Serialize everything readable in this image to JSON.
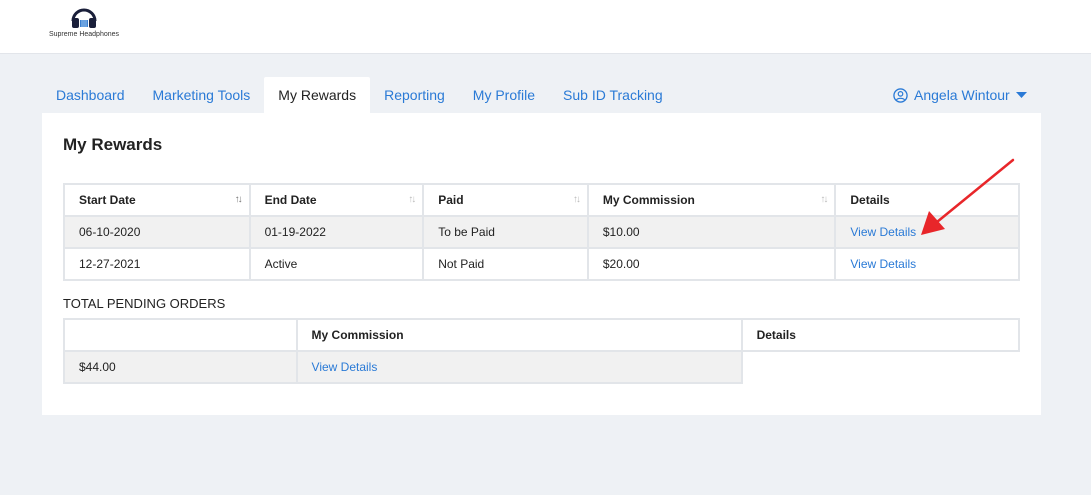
{
  "brand": {
    "name": "Supreme Headphones"
  },
  "tabs": [
    {
      "label": "Dashboard"
    },
    {
      "label": "Marketing Tools"
    },
    {
      "label": "My Rewards"
    },
    {
      "label": "Reporting"
    },
    {
      "label": "My Profile"
    },
    {
      "label": "Sub ID Tracking"
    }
  ],
  "active_tab": "My Rewards",
  "user": {
    "name": "Angela Wintour"
  },
  "page_title": "My Rewards",
  "rewards_table": {
    "headers": [
      "Start Date",
      "End Date",
      "Paid",
      "My Commission",
      "Details"
    ],
    "rows": [
      {
        "start_date": "06-10-2020",
        "end_date": "01-19-2022",
        "paid": "To be Paid",
        "commission": "$10.00",
        "details": "View Details"
      },
      {
        "start_date": "12-27-2021",
        "end_date": "Active",
        "paid": "Not Paid",
        "commission": "$20.00",
        "details": "View Details"
      }
    ]
  },
  "pending": {
    "label": "TOTAL PENDING ORDERS",
    "headers": [
      "",
      "My Commission",
      "Details"
    ],
    "row": {
      "amount": "$44.00",
      "details": "View Details"
    }
  },
  "colors": {
    "link": "#2a7ad6",
    "annotation_arrow": "#e8262a",
    "background": "#eef1f5"
  }
}
